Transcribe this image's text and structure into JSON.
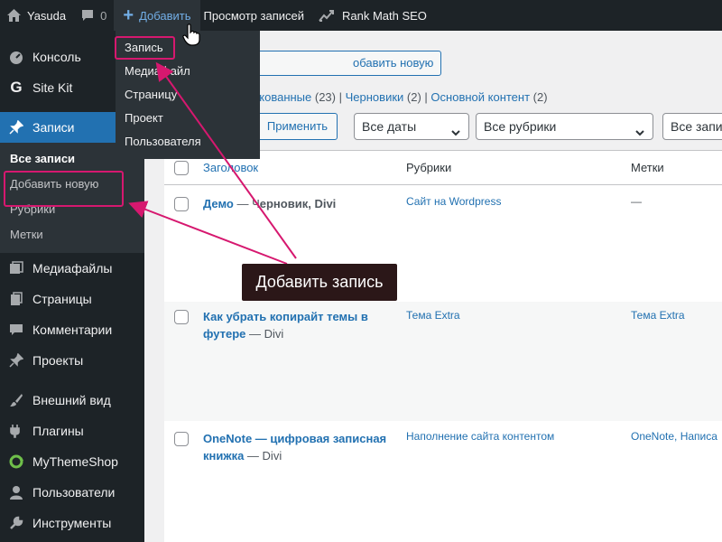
{
  "adminbar": {
    "site_name": "Yasuda",
    "comments_count": "0",
    "add_label": "Добавить",
    "view_posts_label": "Просмотр записей",
    "rank_math_label": "Rank Math SEO"
  },
  "add_menu": {
    "items": [
      "Запись",
      "Медиафайл",
      "Страницу",
      "Проект",
      "Пользователя"
    ]
  },
  "sidebar": {
    "items": [
      {
        "label": "Консоль",
        "icon": "dashboard-icon"
      },
      {
        "label": "Site Kit",
        "icon": "google-icon"
      },
      {
        "label": "Записи",
        "icon": "pin-icon"
      },
      {
        "label": "Медиафайлы",
        "icon": "media-icon"
      },
      {
        "label": "Страницы",
        "icon": "pages-icon"
      },
      {
        "label": "Комментарии",
        "icon": "comments-icon"
      },
      {
        "label": "Проекты",
        "icon": "pin-icon"
      },
      {
        "label": "Внешний вид",
        "icon": "brush-icon"
      },
      {
        "label": "Плагины",
        "icon": "plugin-icon"
      },
      {
        "label": "MyThemeShop",
        "icon": "mythemeshop-icon"
      },
      {
        "label": "Пользователи",
        "icon": "users-icon"
      },
      {
        "label": "Инструменты",
        "icon": "tools-icon"
      }
    ],
    "submenu": [
      "Все записи",
      "Добавить новую",
      "Рубрики",
      "Метки"
    ]
  },
  "main": {
    "add_new_label": "обавить новую",
    "filters": {
      "published_label": "икованные",
      "published_count": "(23)",
      "drafts_label": "Черновики",
      "drafts_count": "(2)",
      "core_label": "Основной контент",
      "core_count": "(2)"
    },
    "apply_label": "Применить",
    "dates_select": "Все даты",
    "cats_select": "Все рубрики",
    "more_select": "Все запис"
  },
  "table": {
    "headers": {
      "title": "Заголовок",
      "categories": "Рубрики",
      "tags": "Метки"
    },
    "rows": [
      {
        "title": "Демо",
        "state_pre": " — Ч",
        "state": "ерновик, Divi",
        "category": "Сайт на Wordpress",
        "tags": "—"
      },
      {
        "title": "Как убрать копирайт темы в футере",
        "state_pre": "",
        "state": " — Divi",
        "category": "Тема Extra",
        "tags": "Тема Extra"
      },
      {
        "title": "OneNote — цифровая записная книжка",
        "state_pre": "",
        "state": " — Divi",
        "category": "Наполнение сайта контентом",
        "tags": "OneNote, Написа"
      }
    ]
  },
  "tooltip": "Добавить запись",
  "colors": {
    "highlight": "#d6186f",
    "link": "#2271b1",
    "sidebar_bg": "#1d2327",
    "current": "#2271b1"
  }
}
